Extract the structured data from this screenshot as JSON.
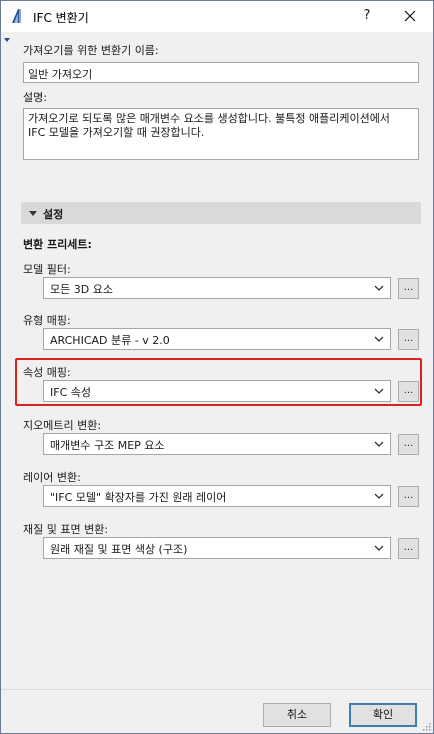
{
  "window": {
    "title": "IFC 변환기",
    "help_label": "?",
    "close_label": "✕"
  },
  "fields": {
    "name_label": "가져오기를 위한 변환기 이름:",
    "name_value": "일반 가져오기",
    "description_label": "설명:",
    "description_value": "가져오기로 되도록 많은 매개변수 요소를 생성합니다. 불특정 애플리케이션에서 IFC 모델을 가져오기할 때 권장합니다."
  },
  "settings": {
    "section_title": "설정",
    "presets_title": "변환 프리세트:",
    "rows": [
      {
        "label": "모델 필터:",
        "value": "모든 3D 요소"
      },
      {
        "label": "유형 매핑:",
        "value": "ARCHICAD 분류 - v 2.0"
      },
      {
        "label": "속성 매핑:",
        "value": "IFC 속성"
      },
      {
        "label": "지오메트리 변환:",
        "value": "매개변수 구조 MEP 요소"
      },
      {
        "label": "레이어 변환:",
        "value": "\"IFC 모델\" 확장자를 가진 원래 레이어"
      },
      {
        "label": "재질 및 표면 변환:",
        "value": "원래 재질 및 표면 색상 (구조)"
      }
    ],
    "more_button_label": "..."
  },
  "footer": {
    "cancel_label": "취소",
    "ok_label": "확인"
  },
  "colors": {
    "highlight": "#e0201f",
    "primary_border": "#3c7fb1",
    "icon_blue": "#1f4f8f"
  },
  "icons": {
    "app": "archicad-icon",
    "section": "expand-triangle-icon",
    "dropdown": "chevron-down-icon"
  }
}
